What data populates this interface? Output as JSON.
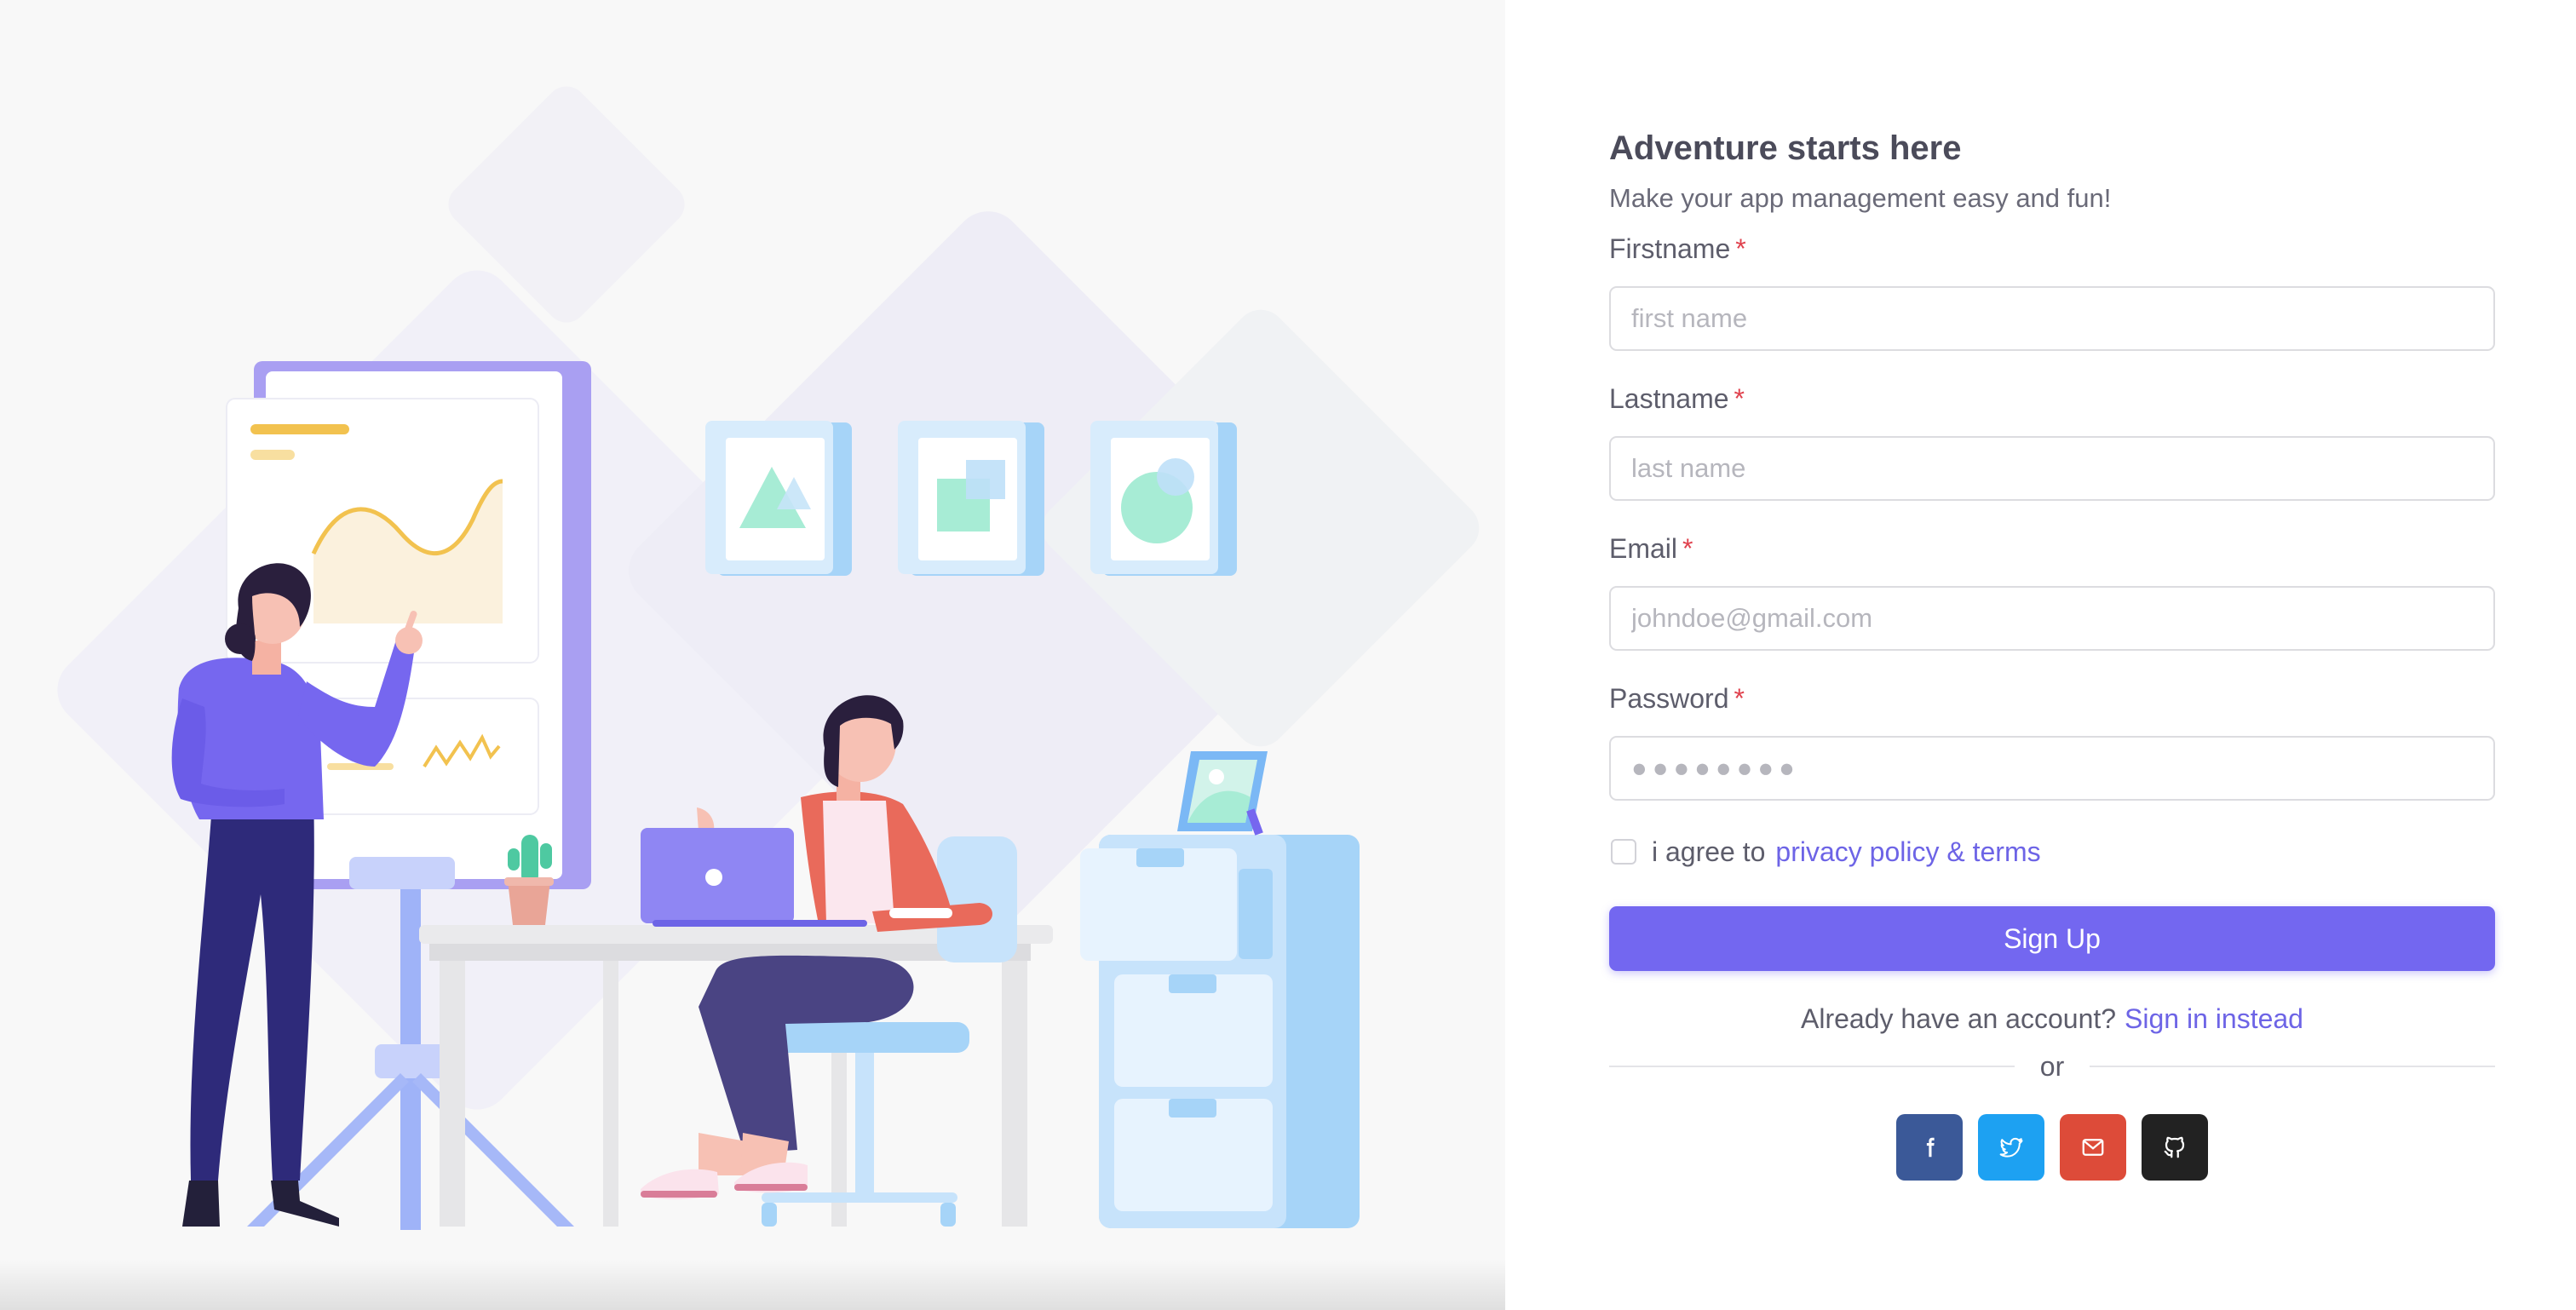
{
  "illustration": {
    "name": "two people working in an office"
  },
  "form": {
    "title": "Adventure starts here",
    "subtitle": "Make your app management easy and fun!",
    "required_marker": "*",
    "fields": [
      {
        "label": "Firstname",
        "placeholder": "first name",
        "type": "text"
      },
      {
        "label": "Lastname",
        "placeholder": "last name",
        "type": "text"
      },
      {
        "label": "Email",
        "placeholder": "johndoe@gmail.com",
        "type": "email"
      },
      {
        "label": "Password",
        "placeholder": "●●●●●●●●",
        "type": "password"
      }
    ],
    "agree_text": "i agree to",
    "agree_link": "privacy policy & terms",
    "agree_checked": false,
    "signup_button": "Sign Up",
    "account_text": "Already have an account?",
    "signin_link": "Sign in instead",
    "divider_text": "or",
    "social": [
      {
        "name": "facebook",
        "icon": "facebook-icon",
        "color": "#3b5998"
      },
      {
        "name": "twitter",
        "icon": "twitter-icon",
        "color": "#1da1f2"
      },
      {
        "name": "google-mail",
        "icon": "mail-icon",
        "color": "#dd4b39"
      },
      {
        "name": "github",
        "icon": "github-icon",
        "color": "#222222"
      }
    ]
  },
  "colors": {
    "primary": "#7367f0",
    "danger": "#ea5455",
    "left_background": "#f8f8f8"
  }
}
